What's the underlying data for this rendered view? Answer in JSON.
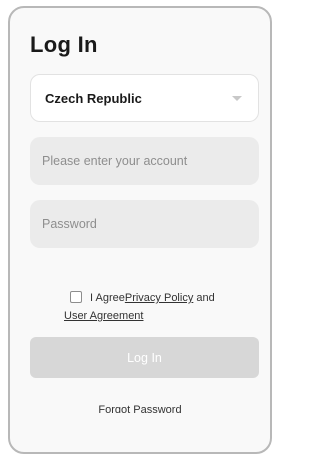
{
  "page": {
    "title": "Log In"
  },
  "country_select": {
    "value": "Czech Republic"
  },
  "account_field": {
    "placeholder": "Please enter your account"
  },
  "password_field": {
    "placeholder": "Password"
  },
  "agreement": {
    "prefix": "I Agree",
    "privacy_link": "Privacy Policy",
    "conjunction": "and",
    "user_agreement_link": "User Agreement"
  },
  "login_button": {
    "label": "Log In"
  },
  "forgot_password": {
    "label": "Forgot Password"
  },
  "colors": {
    "background": "#f9f9f9",
    "input_background": "#ebebeb",
    "disabled_button": "#d7d7d7",
    "text": "#1a1a1a"
  },
  "icons": {
    "dropdown": "chevron-down-icon"
  }
}
